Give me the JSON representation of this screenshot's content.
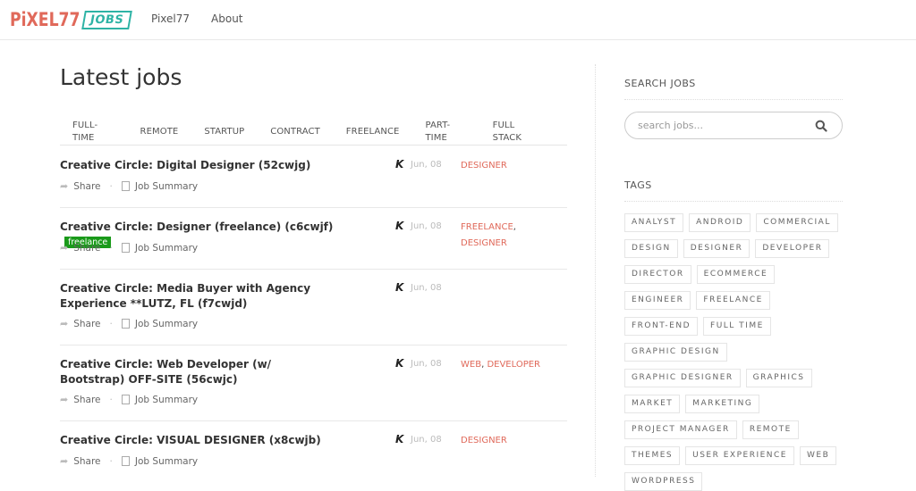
{
  "header": {
    "logo_main": "PiXEL77",
    "logo_badge": "JOBS",
    "nav": [
      {
        "label": "Pixel77"
      },
      {
        "label": "About"
      }
    ]
  },
  "main": {
    "title": "Latest jobs",
    "filters": [
      "FULL-TIME",
      "REMOTE",
      "STARTUP",
      "CONTRACT",
      "FREELANCE",
      "PART-TIME",
      "FULL STACK"
    ],
    "jobs": [
      {
        "title": "Creative Circle: Digital Designer (52cwjg)",
        "badge": "",
        "date": "Jun, 08",
        "tags": [
          "DESIGNER"
        ],
        "share": "Share",
        "summary": "Job Summary"
      },
      {
        "title": "Creative Circle: Designer (freelance) (c6cwjf)",
        "badge": "freelance",
        "date": "Jun, 08",
        "tags": [
          "FREELANCE",
          "DESIGNER"
        ],
        "share": "Share",
        "summary": "Job Summary"
      },
      {
        "title": "Creative Circle: Media Buyer with Agency Experience **LUTZ, FL (f7cwjd)",
        "badge": "",
        "date": "Jun, 08",
        "tags": [],
        "share": "Share",
        "summary": "Job Summary"
      },
      {
        "title": "Creative Circle: Web Developer (w/ Bootstrap) OFF-SITE (56cwjc)",
        "badge": "",
        "date": "Jun, 08",
        "tags": [
          "WEB",
          "DEVELOPER"
        ],
        "share": "Share",
        "summary": "Job Summary"
      },
      {
        "title": "Creative Circle: VISUAL DESIGNER (x8cwjb)",
        "badge": "",
        "date": "Jun, 08",
        "tags": [
          "DESIGNER"
        ],
        "share": "Share",
        "summary": "Job Summary"
      }
    ]
  },
  "sidebar": {
    "search_title": "SEARCH JOBS",
    "search_placeholder": "search jobs...",
    "search_value": "",
    "tags_title": "TAGS",
    "tags": [
      "ANALYST",
      "ANDROID",
      "COMMERCIAL",
      "DESIGN",
      "DESIGNER",
      "DEVELOPER",
      "DIRECTOR",
      "ECOMMERCE",
      "ENGINEER",
      "FREELANCE",
      "FRONT-END",
      "FULL TIME",
      "GRAPHIC DESIGN",
      "GRAPHIC DESIGNER",
      "GRAPHICS",
      "MARKET",
      "MARKETING",
      "PROJECT MANAGER",
      "REMOTE",
      "THEMES",
      "USER EXPERIENCE",
      "WEB",
      "WORDPRESS"
    ]
  },
  "colors": {
    "brand_red": "#e0695a",
    "brand_teal": "#2eb3a5",
    "badge_green": "#1a9a1a"
  }
}
